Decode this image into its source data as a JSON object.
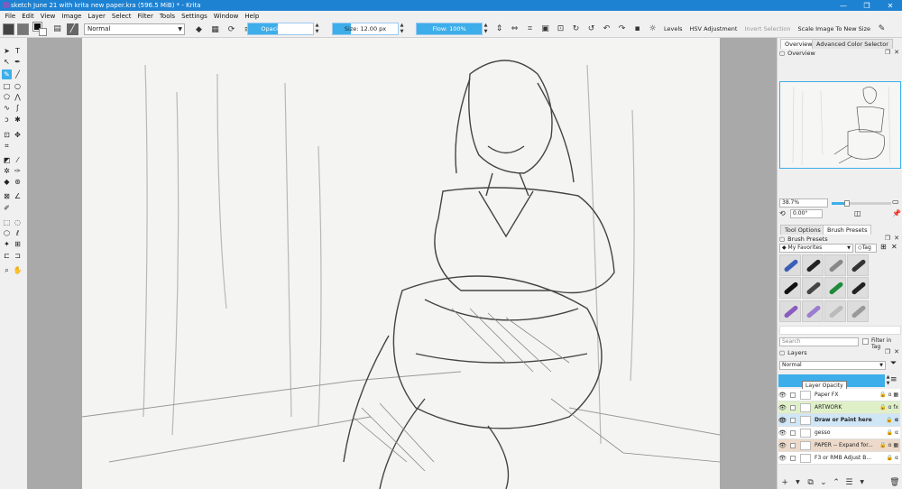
{
  "window": {
    "title": "sketch June 21 with krita new paper.kra (596.5 MiB) * - Krita",
    "minimize": "—",
    "maximize": "❐",
    "close": "✕"
  },
  "menu": [
    "File",
    "Edit",
    "View",
    "Image",
    "Layer",
    "Select",
    "Filter",
    "Tools",
    "Settings",
    "Window",
    "Help"
  ],
  "toolbar": {
    "blend_mode": "Normal",
    "opacity_label": "Opacity: 46%",
    "opacity_value": 0.46,
    "size_label": "Size: 12.00 px",
    "flow_label": "Flow: 100%",
    "flow_value": 1.0,
    "levels": "Levels",
    "hsv": "HSV Adjustment",
    "invert_selection": "Invert Selection",
    "scale_image": "Scale Image To New Size",
    "colors": {
      "accent": "#3daee9",
      "title": "#1e82d2"
    }
  },
  "dock": {
    "tabs": [
      "Overview",
      "Advanced Color Selector"
    ],
    "overview_title": "Overview",
    "zoom": "38.7%",
    "rotation": "0.00°",
    "tool_tabs": [
      "Tool Options",
      "Brush Presets"
    ],
    "brush_presets_title": "Brush Presets",
    "favorites": "My Favorites",
    "tag": "Tag",
    "search_placeholder": "Search",
    "filter_in_tag": "Filter in Tag",
    "layers_title": "Layers",
    "layers_blend": "Normal",
    "layer_opacity_label": "Layer Opacity",
    "layers": [
      {
        "name": "Paper FX",
        "color": "#ffffff",
        "icons": "🔒 α ▦"
      },
      {
        "name": "ARTWORK",
        "color": "#dff0c8",
        "icons": "🔒 α fx"
      },
      {
        "name": "Draw or Paint here",
        "color": "#cfe6f7",
        "icons": "🔒 α"
      },
      {
        "name": "gesso",
        "color": "#ffffff",
        "icons": "🔒 α"
      },
      {
        "name": "PAPER -- Expand for...",
        "color": "#ecd9c9",
        "icons": "🔒 α ▦"
      },
      {
        "name": "F3 or RMB Adjust B...",
        "color": "#ffffff",
        "icons": "🔒 α"
      }
    ]
  }
}
